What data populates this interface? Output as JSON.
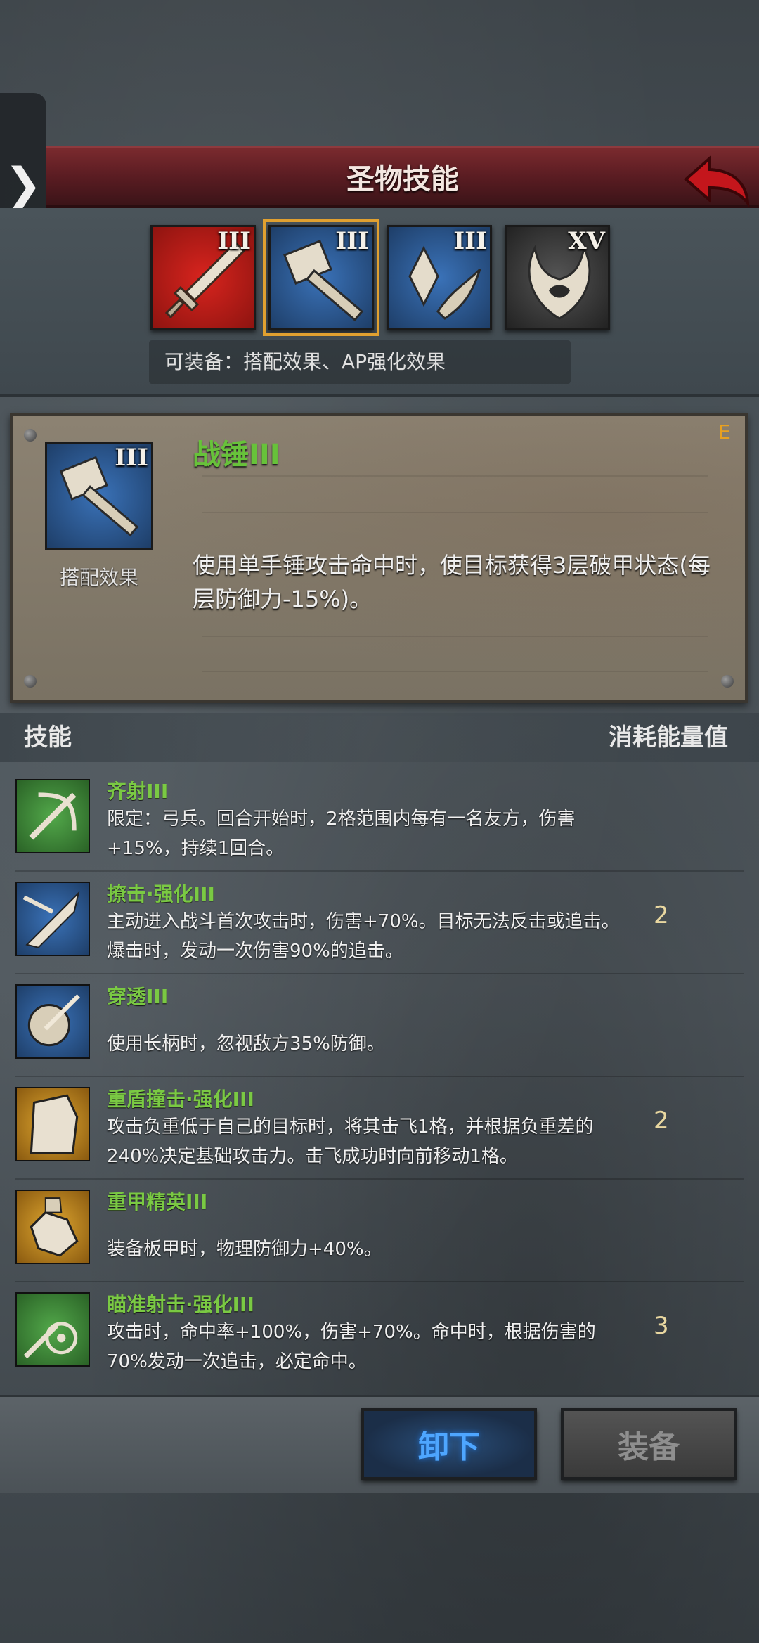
{
  "header": {
    "title": "圣物技能"
  },
  "relics": [
    {
      "level": "III",
      "icon": "sword-icon",
      "color": "#b81b16",
      "selected": false
    },
    {
      "level": "III",
      "icon": "war-hammer-icon",
      "color": "#2f5e9a",
      "selected": true
    },
    {
      "level": "III",
      "icon": "crystal-claw-icon",
      "color": "#2f5e9a",
      "selected": false
    },
    {
      "level": "XV",
      "icon": "horned-flame-icon",
      "color": "#3a3a3a",
      "selected": false
    }
  ],
  "equip_note": "可装备：搭配效果、AP强化效果",
  "card": {
    "rank": "E",
    "title": "战锤III",
    "icon_level": "III",
    "icon_label": "搭配效果",
    "description": "使用单手锤攻击命中时，使目标获得3层破甲状态(每层防御力-15%)。"
  },
  "skills_header": {
    "left": "技能",
    "right": "消耗能量值"
  },
  "skills": [
    {
      "name": "齐射III",
      "desc": "限定：弓兵。回合开始时，2格范围内每有一名友方，伤害+15%，持续1回合。",
      "cost": "",
      "icon": "bow-arrow-icon",
      "color": "#3f8f3a"
    },
    {
      "name": "撩击·强化III",
      "desc": "主动进入战斗首次攻击时，伤害+70%。目标无法反击或追击。爆击时，发动一次伤害90%的追击。",
      "cost": "2",
      "icon": "slash-icon",
      "color": "#2f5e9a"
    },
    {
      "name": "穿透III",
      "desc": "使用长柄时，忽视敌方35%防御。",
      "cost": "",
      "icon": "pierce-shield-icon",
      "color": "#2f5e9a"
    },
    {
      "name": "重盾撞击·强化III",
      "desc": "攻击负重低于自己的目标时，将其击飞1格，并根据负重差的240%决定基础攻击力。击飞成功时向前移动1格。",
      "cost": "2",
      "icon": "heavy-shield-icon",
      "color": "#c89020"
    },
    {
      "name": "重甲精英III",
      "desc": "装备板甲时，物理防御力+40%。",
      "cost": "",
      "icon": "plate-armor-icon",
      "color": "#c89020"
    },
    {
      "name": "瞄准射击·强化III",
      "desc": "攻击时，命中率+100%，伤害+70%。命中时，根据伤害的70%发动一次追击，必定命中。",
      "cost": "3",
      "icon": "crosshair-icon",
      "color": "#3f8f3a"
    }
  ],
  "buttons": {
    "unequip": "卸下",
    "equip": "装备"
  }
}
